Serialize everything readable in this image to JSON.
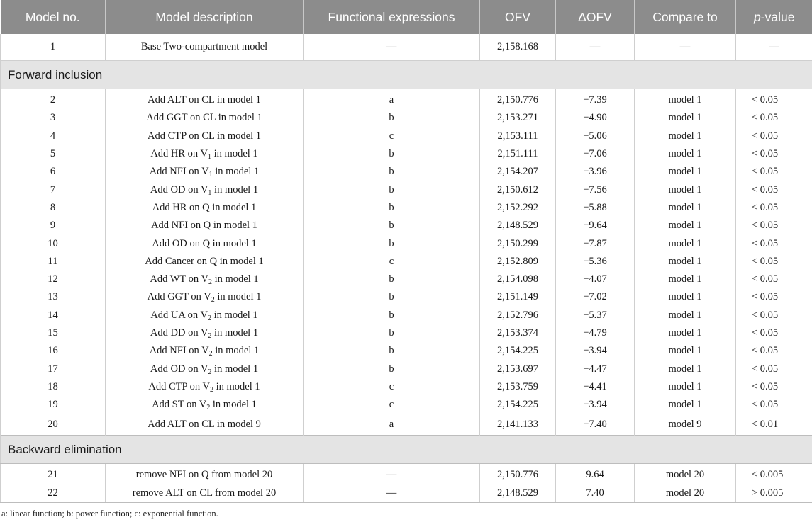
{
  "headers": {
    "model_no": "Model no.",
    "description": "Model description",
    "functional": "Functional expressions",
    "ofv": "OFV",
    "delta_ofv": "ΔOFV",
    "compare_to": "Compare to",
    "p_value_italic": "p",
    "p_value_rest": "-value"
  },
  "base_row": {
    "no": "1",
    "pre": "Base Two-compartment model",
    "sub": "",
    "post": "",
    "func": "—",
    "ofv": "2,158.168",
    "delta": "—",
    "compare": "—",
    "p": "—"
  },
  "sections": {
    "forward": "Forward inclusion",
    "backward": "Backward elimination"
  },
  "forward_rows": [
    {
      "no": "2",
      "pre": "Add ALT on CL in model 1",
      "sub": "",
      "post": "",
      "func": "a",
      "ofv": "2,150.776",
      "delta": "−7.39",
      "compare": "model 1",
      "p": "< 0.05"
    },
    {
      "no": "3",
      "pre": "Add GGT on CL in model 1",
      "sub": "",
      "post": "",
      "func": "b",
      "ofv": "2,153.271",
      "delta": "−4.90",
      "compare": "model 1",
      "p": "< 0.05"
    },
    {
      "no": "4",
      "pre": "Add CTP on CL in model 1",
      "sub": "",
      "post": "",
      "func": "c",
      "ofv": "2,153.111",
      "delta": "−5.06",
      "compare": "model 1",
      "p": "< 0.05"
    },
    {
      "no": "5",
      "pre": "Add HR on V",
      "sub": "1",
      "post": " in model 1",
      "func": "b",
      "ofv": "2,151.111",
      "delta": "−7.06",
      "compare": "model 1",
      "p": "< 0.05"
    },
    {
      "no": "6",
      "pre": "Add NFI on V",
      "sub": "1",
      "post": " in model 1",
      "func": "b",
      "ofv": "2,154.207",
      "delta": "−3.96",
      "compare": "model 1",
      "p": "< 0.05"
    },
    {
      "no": "7",
      "pre": "Add OD on V",
      "sub": "1",
      "post": " in model 1",
      "func": "b",
      "ofv": "2,150.612",
      "delta": "−7.56",
      "compare": "model 1",
      "p": "< 0.05"
    },
    {
      "no": "8",
      "pre": "Add HR on Q in model 1",
      "sub": "",
      "post": "",
      "func": "b",
      "ofv": "2,152.292",
      "delta": "−5.88",
      "compare": "model 1",
      "p": "< 0.05"
    },
    {
      "no": "9",
      "pre": "Add NFI on Q in model 1",
      "sub": "",
      "post": "",
      "func": "b",
      "ofv": "2,148.529",
      "delta": "−9.64",
      "compare": "model 1",
      "p": "< 0.05"
    },
    {
      "no": "10",
      "pre": "Add OD on Q in model 1",
      "sub": "",
      "post": "",
      "func": "b",
      "ofv": "2,150.299",
      "delta": "−7.87",
      "compare": "model 1",
      "p": "< 0.05"
    },
    {
      "no": "11",
      "pre": "Add Cancer on Q in model 1",
      "sub": "",
      "post": "",
      "func": "c",
      "ofv": "2,152.809",
      "delta": "−5.36",
      "compare": "model 1",
      "p": "< 0.05"
    },
    {
      "no": "12",
      "pre": "Add WT on V",
      "sub": "2",
      "post": " in model 1",
      "func": "b",
      "ofv": "2,154.098",
      "delta": "−4.07",
      "compare": "model 1",
      "p": "< 0.05"
    },
    {
      "no": "13",
      "pre": "Add GGT on V",
      "sub": "2",
      "post": " in model 1",
      "func": "b",
      "ofv": "2,151.149",
      "delta": "−7.02",
      "compare": "model 1",
      "p": "< 0.05"
    },
    {
      "no": "14",
      "pre": "Add UA on V",
      "sub": "2",
      "post": " in model 1",
      "func": "b",
      "ofv": "2,152.796",
      "delta": "−5.37",
      "compare": "model 1",
      "p": "< 0.05"
    },
    {
      "no": "15",
      "pre": "Add DD on V",
      "sub": "2",
      "post": " in model 1",
      "func": "b",
      "ofv": "2,153.374",
      "delta": "−4.79",
      "compare": "model 1",
      "p": "< 0.05"
    },
    {
      "no": "16",
      "pre": "Add NFI on V",
      "sub": "2",
      "post": " in model 1",
      "func": "b",
      "ofv": "2,154.225",
      "delta": "−3.94",
      "compare": "model 1",
      "p": "< 0.05"
    },
    {
      "no": "17",
      "pre": "Add OD on V",
      "sub": "2",
      "post": " in model 1",
      "func": "b",
      "ofv": "2,153.697",
      "delta": "−4.47",
      "compare": "model 1",
      "p": "< 0.05"
    },
    {
      "no": "18",
      "pre": "Add CTP on V",
      "sub": "2",
      "post": " in model 1",
      "func": "c",
      "ofv": "2,153.759",
      "delta": "−4.41",
      "compare": "model 1",
      "p": "< 0.05"
    },
    {
      "no": "19",
      "pre": "Add ST on V",
      "sub": "2",
      "post": " in model 1",
      "func": "c",
      "ofv": "2,154.225",
      "delta": "−3.94",
      "compare": "model 1",
      "p": "< 0.05"
    },
    {
      "no": "20",
      "pre": "Add ALT on CL in model 9",
      "sub": "",
      "post": "",
      "func": "a",
      "ofv": "2,141.133",
      "delta": "−7.40",
      "compare": "model 9",
      "p": "< 0.01"
    }
  ],
  "backward_rows": [
    {
      "no": "21",
      "pre": "remove NFI on Q from model 20",
      "sub": "",
      "post": "",
      "func": "—",
      "ofv": "2,150.776",
      "delta": "9.64",
      "compare": "model 20",
      "p": "< 0.005"
    },
    {
      "no": "22",
      "pre": "remove ALT on CL from model 20",
      "sub": "",
      "post": "",
      "func": "—",
      "ofv": "2,148.529",
      "delta": "7.40",
      "compare": "model 20",
      "p": "> 0.005"
    }
  ],
  "footnote": "a: linear function; b: power function; c: exponential function."
}
